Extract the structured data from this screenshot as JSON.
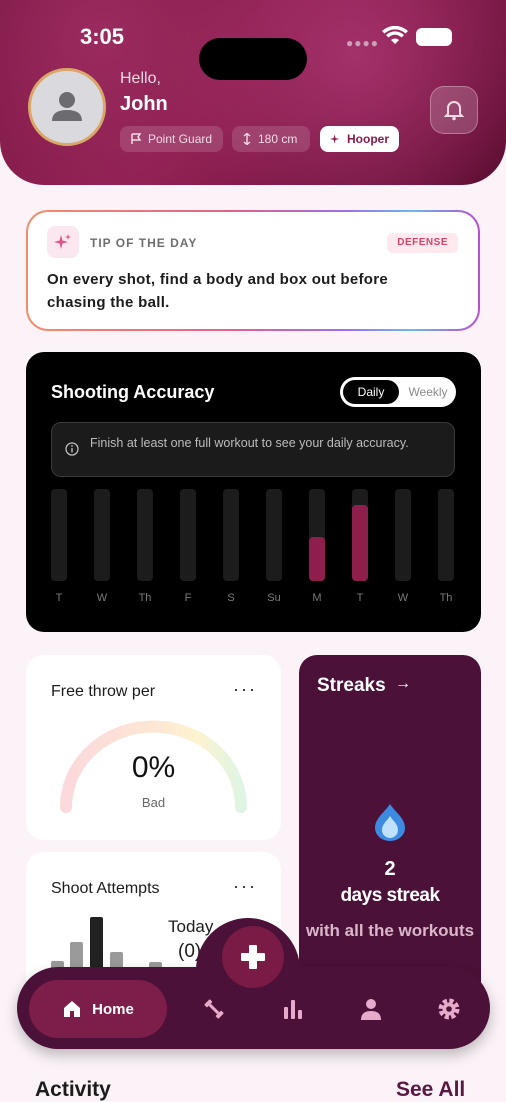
{
  "status_bar": {
    "time": "3:05"
  },
  "header": {
    "greeting": "Hello,",
    "name": "John",
    "chips": [
      {
        "icon": "flag-icon",
        "label": "Point Guard"
      },
      {
        "icon": "height-icon",
        "label": "180 cm"
      },
      {
        "icon": "sparkle-icon",
        "label": "Hooper"
      }
    ]
  },
  "tip": {
    "title": "TIP OF THE DAY",
    "tag": "DEFENSE",
    "text": "On every shot, find a body and box out before chasing the ball."
  },
  "accuracy": {
    "title": "Shooting Accuracy",
    "toggle": {
      "daily": "Daily",
      "weekly": "Weekly",
      "selected": "Daily"
    },
    "notice": "Finish at least one full workout to see your daily accuracy.",
    "accent": "#8e1f4c"
  },
  "chart_data": {
    "type": "bar",
    "categories": [
      "T",
      "W",
      "Th",
      "F",
      "S",
      "Su",
      "M",
      "T",
      "W",
      "Th"
    ],
    "values": [
      0,
      0,
      0,
      0,
      0,
      0,
      0.48,
      0.83,
      0,
      0
    ],
    "ylim": [
      0,
      1
    ],
    "title": "",
    "xlabel": "",
    "ylabel": ""
  },
  "free_throw": {
    "title": "Free throw per",
    "value": "0%",
    "rating": "Bad",
    "more": "···"
  },
  "shoot_attempts": {
    "title": "Shoot Attempts",
    "today_label": "Today",
    "count": "(0)",
    "more": "···"
  },
  "streaks": {
    "title": "Streaks",
    "arrow": "→",
    "count": "2",
    "days_label": "days streak",
    "sub": "with all the workouts"
  },
  "nav": {
    "home": "Home",
    "items": [
      "dumbbell-icon",
      "stats-icon",
      "profile-icon",
      "settings-icon"
    ]
  },
  "activity": {
    "title": "Activity",
    "see_all": "See All"
  }
}
